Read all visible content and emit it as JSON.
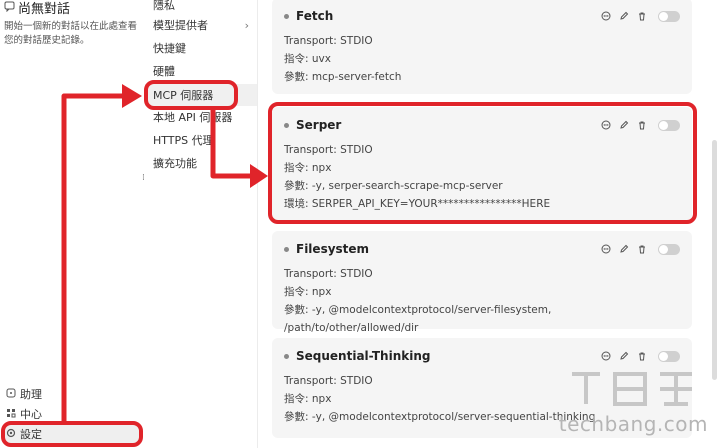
{
  "sidebar": {
    "chat_title": "尚無對話",
    "chat_hint": "開始一個新的對話以在此處查看您的對話歷史記錄。",
    "bottom_items": [
      {
        "label": "助理",
        "icon": "help-icon"
      },
      {
        "label": "中心",
        "icon": "hub-icon"
      },
      {
        "label": "設定",
        "icon": "gear-icon"
      }
    ]
  },
  "menu": {
    "items": [
      {
        "label": "隱私"
      },
      {
        "label": "模型提供者"
      },
      {
        "label": "快捷鍵"
      },
      {
        "label": "硬體"
      },
      {
        "label": "MCP 伺服器"
      },
      {
        "label": "本地 API 伺服器"
      },
      {
        "label": "HTTPS 代理"
      },
      {
        "label": "擴充功能"
      }
    ],
    "active": "MCP 伺服器"
  },
  "servers": [
    {
      "name": "Fetch",
      "transport": "Transport: STDIO",
      "command": "指令: uvx",
      "args": "參數: mcp-server-fetch"
    },
    {
      "name": "Serper",
      "transport": "Transport: STDIO",
      "command": "指令: npx",
      "args": "參數: -y, serper-search-scrape-mcp-server",
      "env": "環境: SERPER_API_KEY=YOUR****************HERE"
    },
    {
      "name": "Filesystem",
      "transport": "Transport: STDIO",
      "command": "指令: npx",
      "args": "參數: -y, @modelcontextprotocol/server-filesystem, /path/to/other/allowed/dir"
    },
    {
      "name": "Sequential-Thinking",
      "transport": "Transport: STDIO",
      "command": "指令: npx",
      "args": "參數: -y, @modelcontextprotocol/server-sequential-thinking"
    }
  ],
  "watermark": "techbang.com",
  "colors": {
    "highlight": "#e0242a",
    "card_bg": "#f5f5f5",
    "active_menu": "#f0f0f0"
  }
}
